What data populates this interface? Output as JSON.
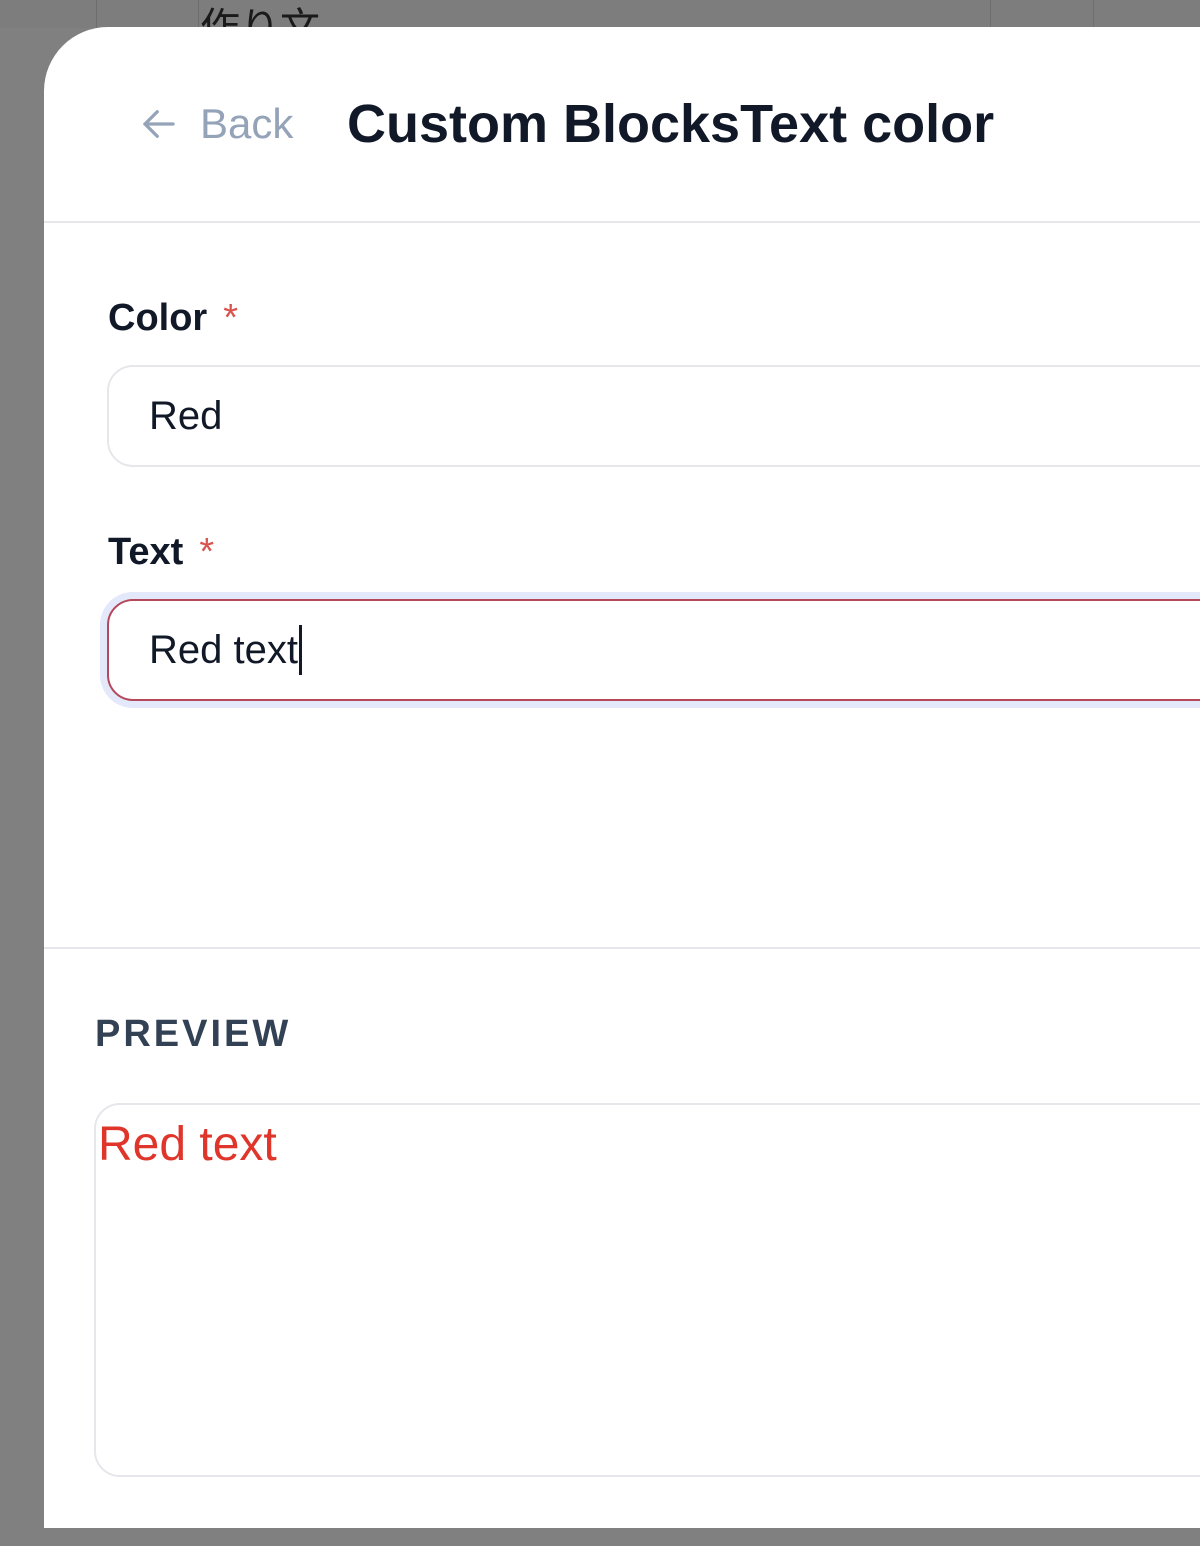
{
  "background_page": {
    "partial_text": "作り文"
  },
  "header": {
    "back_label": "Back",
    "back_icon": "arrow-left-icon",
    "title": "Custom BlocksText color"
  },
  "form": {
    "color_field": {
      "label": "Color",
      "required_marker": "*",
      "value": "Red"
    },
    "text_field": {
      "label": "Text",
      "required_marker": "*",
      "value": "Red text",
      "focused": true
    }
  },
  "preview": {
    "section_title": "PREVIEW",
    "text": "Red text",
    "text_color": "#e0352b"
  },
  "colors": {
    "overlay": "#808080",
    "required": "#d9534f",
    "focus_border": "#b5485a",
    "focus_ring": "#e3e8fb",
    "muted": "#94a3b8"
  }
}
